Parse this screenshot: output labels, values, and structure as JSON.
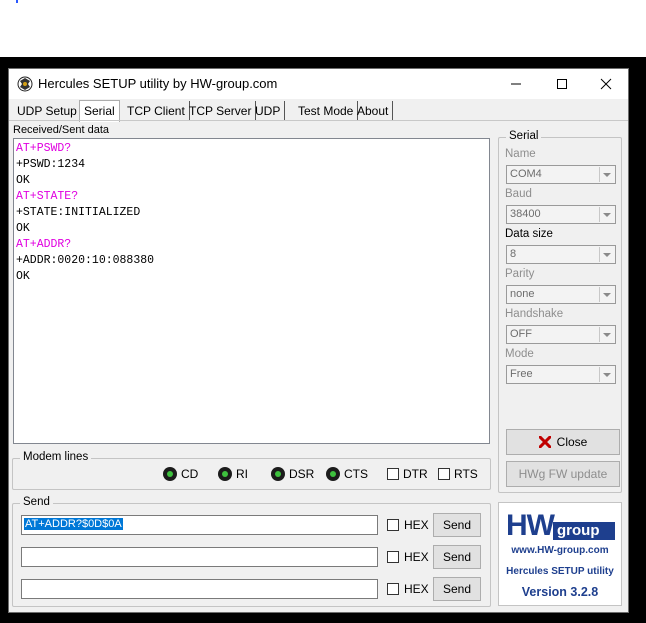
{
  "window": {
    "title": "Hercules SETUP utility by HW-group.com"
  },
  "tabs": [
    "UDP Setup",
    "Serial",
    "TCP Client",
    "TCP Server",
    "UDP",
    "Test Mode",
    "About"
  ],
  "active_tab": "Serial",
  "received": {
    "label": "Received/Sent data",
    "lines": [
      {
        "text": "AT+PSWD?",
        "type": "cmd"
      },
      {
        "text": "+PSWD:1234",
        "type": "resp"
      },
      {
        "text": "OK",
        "type": "resp"
      },
      {
        "text": "AT+STATE?",
        "type": "cmd"
      },
      {
        "text": "+STATE:INITIALIZED",
        "type": "resp"
      },
      {
        "text": "OK",
        "type": "resp"
      },
      {
        "text": "AT+ADDR?",
        "type": "cmd"
      },
      {
        "text": "+ADDR:0020:10:088380",
        "type": "resp"
      },
      {
        "text": "OK",
        "type": "resp"
      }
    ],
    "colors": {
      "cmd": "#e000e0",
      "resp": "#000000"
    }
  },
  "modem": {
    "title": "Modem lines",
    "leds": [
      "CD",
      "RI",
      "DSR",
      "CTS"
    ],
    "checks": [
      "DTR",
      "RTS"
    ]
  },
  "send": {
    "title": "Send",
    "rows": [
      {
        "value": "AT+ADDR?$0D$0A",
        "hex": "HEX",
        "button": "Send"
      },
      {
        "value": "",
        "hex": "HEX",
        "button": "Send"
      },
      {
        "value": "",
        "hex": "HEX",
        "button": "Send"
      }
    ]
  },
  "serial": {
    "title": "Serial",
    "name_label": "Name",
    "name_value": "COM4",
    "baud_label": "Baud",
    "baud_value": "38400",
    "datasize_label": "Data size",
    "datasize_value": "8",
    "parity_label": "Parity",
    "parity_value": "none",
    "handshake_label": "Handshake",
    "handshake_value": "OFF",
    "mode_label": "Mode",
    "mode_value": "Free"
  },
  "buttons": {
    "close": "Close",
    "hwg_update": "HWg FW update"
  },
  "logo": {
    "hw": "HW",
    "group": "group",
    "url": "www.HW-group.com",
    "product": "Hercules SETUP utility",
    "version": "Version  3.2.8"
  }
}
